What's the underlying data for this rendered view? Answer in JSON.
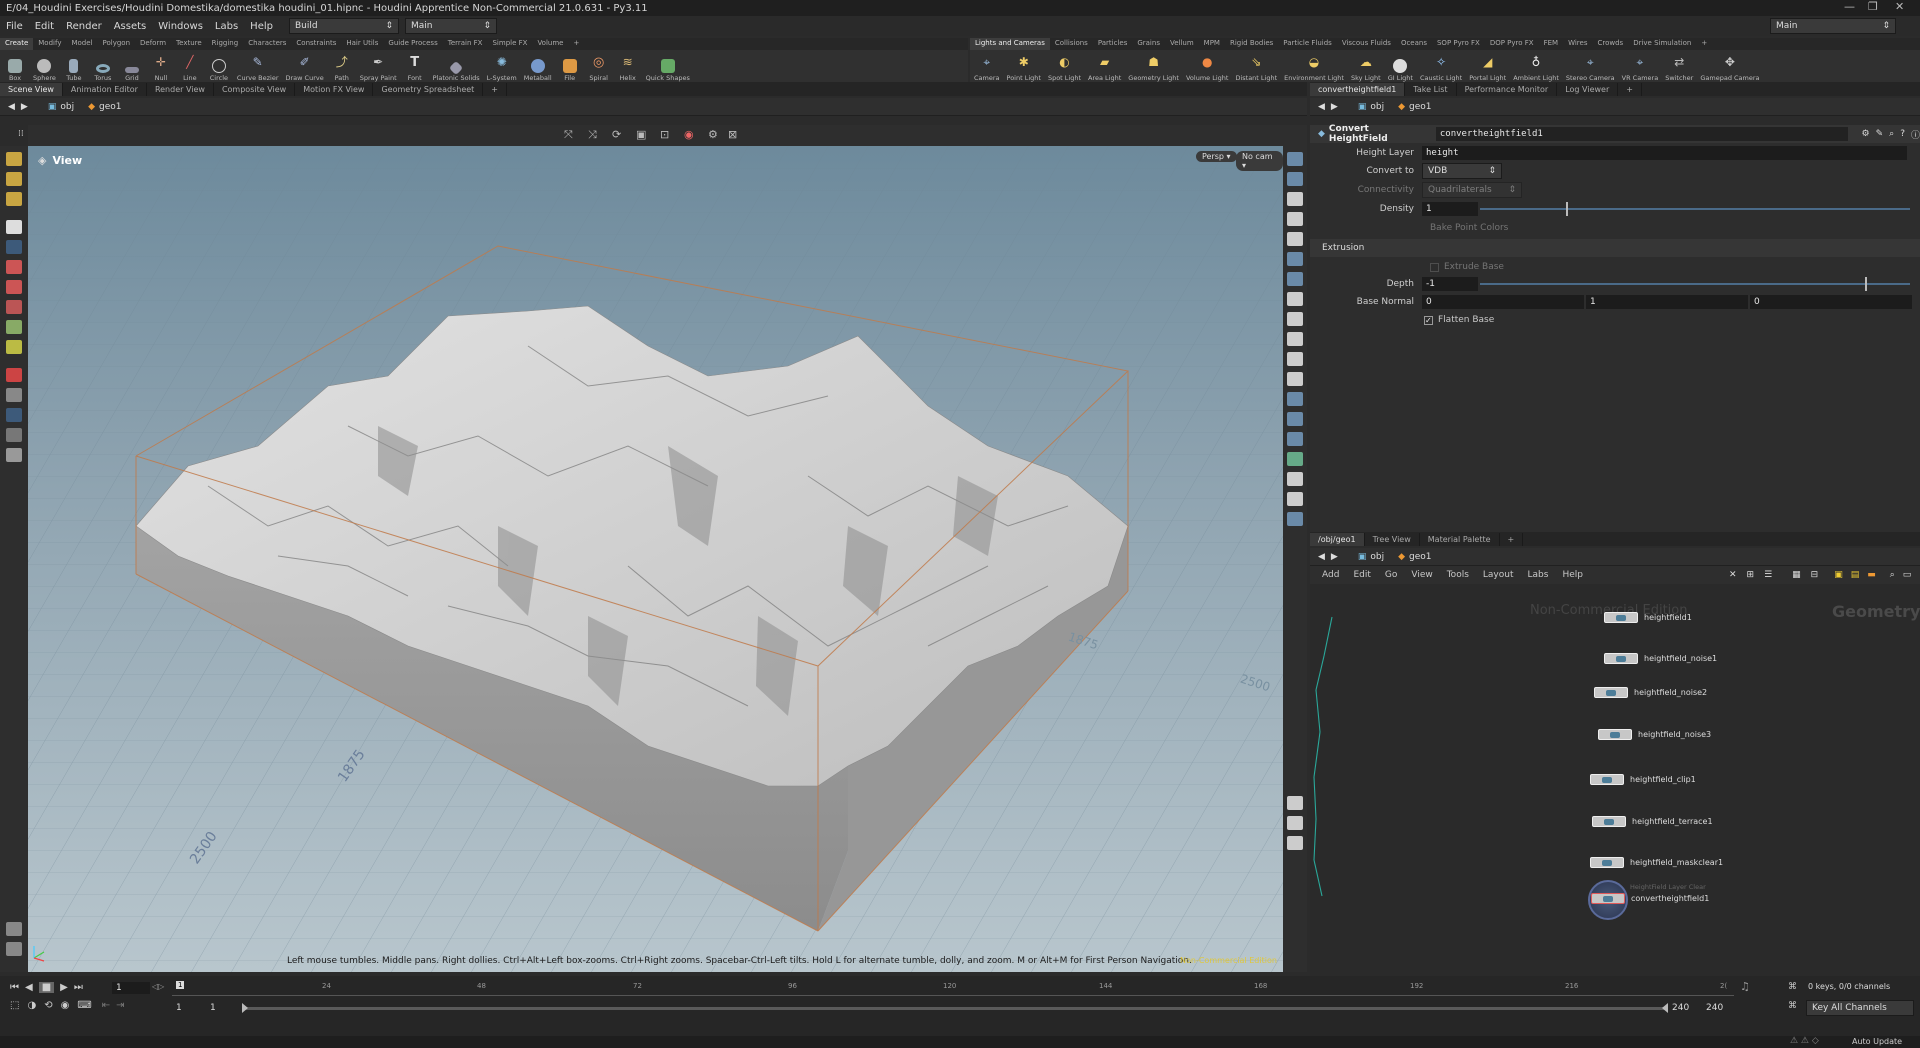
{
  "title": "E/04_Houdini Exercises/Houdini Domestika/domestika houdini_01.hipnc - Houdini Apprentice Non-Commercial 21.0.631 - Py3.11",
  "menu": [
    "File",
    "Edit",
    "Render",
    "Assets",
    "Windows",
    "Labs",
    "Help"
  ],
  "desktop": "Build",
  "layout": "Main",
  "desktop_right": "Main",
  "shelf_left": {
    "tabs": [
      "Create",
      "Modify",
      "Model",
      "Polygon",
      "Deform",
      "Texture",
      "Rigging",
      "Characters",
      "Constraints",
      "Hair Utils",
      "Guide Process",
      "Terrain FX",
      "Simple FX",
      "Volume"
    ],
    "tools": [
      "Box",
      "Sphere",
      "Tube",
      "Torus",
      "Grid",
      "Null",
      "Line",
      "Circle",
      "Curve Bezier",
      "Draw Curve",
      "Path",
      "Spray Paint",
      "Font",
      "Platonic Solids",
      "L-System",
      "Metaball",
      "File",
      "Spiral",
      "Helix",
      "Quick Shapes"
    ]
  },
  "shelf_right": {
    "tabs": [
      "Lights and Cameras",
      "Collisions",
      "Particles",
      "Grains",
      "Vellum",
      "MPM",
      "Rigid Bodies",
      "Particle Fluids",
      "Viscous Fluids",
      "Oceans",
      "SOP Pyro FX",
      "DOP Pyro FX",
      "FEM",
      "Wires",
      "Crowds",
      "Drive Simulation"
    ],
    "tools": [
      "Camera",
      "Point Light",
      "Spot Light",
      "Area Light",
      "Geometry Light",
      "Volume Light",
      "Distant Light",
      "Environment Light",
      "Sky Light",
      "GI Light",
      "Caustic Light",
      "Portal Light",
      "Ambient Light",
      "Stereo Camera",
      "VR Camera",
      "Switcher",
      "Gamepad Camera"
    ]
  },
  "pane_tabs_left": [
    "Scene View",
    "Animation Editor",
    "Render View",
    "Composite View",
    "Motion FX View",
    "Geometry Spreadsheet"
  ],
  "pane_tabs_right": [
    "convertheightfield1",
    "Take List",
    "Performance Monitor",
    "Log Viewer"
  ],
  "path": {
    "root": "obj",
    "node": "geo1"
  },
  "viewport": {
    "label": "View",
    "persp": "Persp ▾",
    "cam": "No cam ▾",
    "grid_labels": [
      "1875",
      "2500",
      "1875",
      "2500"
    ],
    "help": "Left mouse tumbles. Middle pans. Right dollies. Ctrl+Alt+Left box-zooms. Ctrl+Right zooms. Spacebar-Ctrl-Left tilts. Hold L for alternate tumble, dolly, and zoom. M or Alt+M for First Person Navigation.",
    "edition": "Non-Commercial Edition"
  },
  "params": {
    "type": "Convert HeightField",
    "name": "convertheightfield1",
    "height_layer_label": "Height Layer",
    "height_layer": "height",
    "convert_to_label": "Convert to",
    "convert_to": "VDB",
    "connectivity_label": "Connectivity",
    "connectivity": "Quadrilaterals",
    "density_label": "Density",
    "density": "1",
    "bake_colors": "Bake Point Colors",
    "extrusion": "Extrusion",
    "extrude_base": "Extrude Base",
    "depth_label": "Depth",
    "depth": "-1",
    "base_normal_label": "Base Normal",
    "base_normal": [
      "0",
      "1",
      "0"
    ],
    "flatten_base": "Flatten Base"
  },
  "network": {
    "tabs": [
      "/obj/geo1",
      "Tree View",
      "Material Palette"
    ],
    "menu": [
      "Add",
      "Edit",
      "Go",
      "View",
      "Tools",
      "Layout",
      "Labs",
      "Help"
    ],
    "watermark": "Non-Commercial Edition",
    "context": "Geometry",
    "node_comment": "HeightField Layer Clear",
    "nodes": [
      "heightfield1",
      "heightfield_noise1",
      "heightfield_noise2",
      "heightfield_noise3",
      "heightfield_clip1",
      "heightfield_terrace1",
      "heightfield_maskclear1",
      "convertheightfield1"
    ]
  },
  "timeline": {
    "frame": "1",
    "ticks": [
      "24",
      "48",
      "72",
      "96",
      "120",
      "144",
      "168",
      "192",
      "216",
      "2("
    ],
    "start": "1",
    "start2": "1",
    "end": "240",
    "end2": "240",
    "keys": "0 keys, 0/0 channels",
    "key_all": "Key All Channels",
    "auto_update": "Auto Update"
  }
}
